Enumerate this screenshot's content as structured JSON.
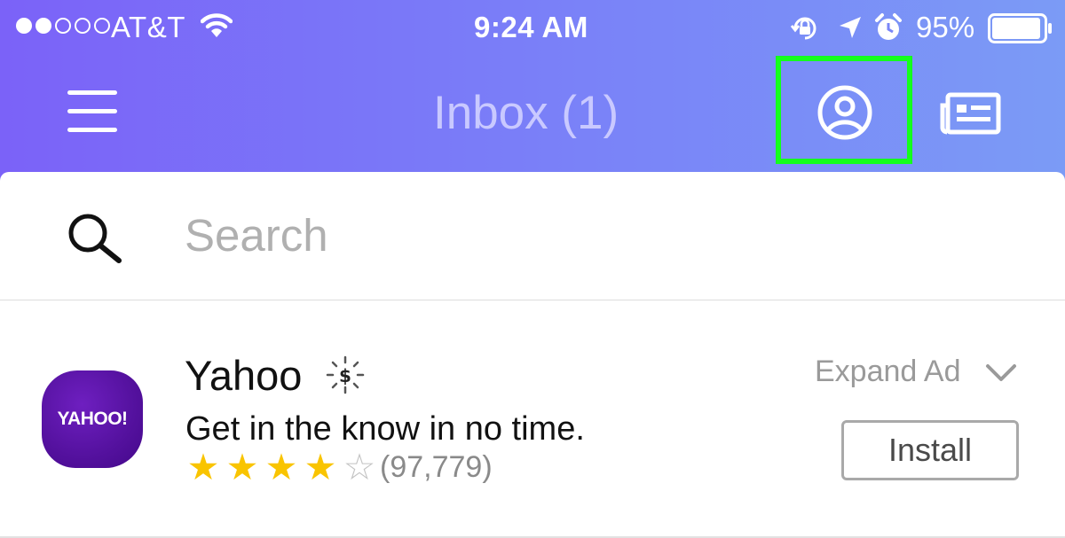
{
  "status_bar": {
    "signal_strength": 2,
    "signal_total": 5,
    "carrier": "AT&T",
    "time": "9:24 AM",
    "battery_percent": "95%",
    "battery_level": 0.95,
    "icons": [
      "wifi-icon",
      "rotation-lock-icon",
      "location-icon",
      "alarm-icon",
      "battery-icon"
    ]
  },
  "nav": {
    "title": "Inbox (1)",
    "left_icon": "hamburger-menu-icon",
    "right_icons": [
      "profile-icon",
      "news-icon"
    ],
    "highlight_color": "#14ff1c"
  },
  "search": {
    "placeholder": "Search",
    "icon": "search-icon"
  },
  "ad": {
    "app_name": "Yahoo",
    "app_icon_text": "YAHOO!",
    "sponsored_icon": "sponsored-dollar-icon",
    "tagline": "Get in the know in no time.",
    "rating": 4,
    "rating_max": 5,
    "rating_count": "(97,779)",
    "expand_label": "Expand Ad",
    "install_label": "Install"
  },
  "colors": {
    "header_start": "#7b62f8",
    "header_end": "#7b9bf6",
    "star": "#f9c400",
    "app_icon": "#54119e"
  }
}
